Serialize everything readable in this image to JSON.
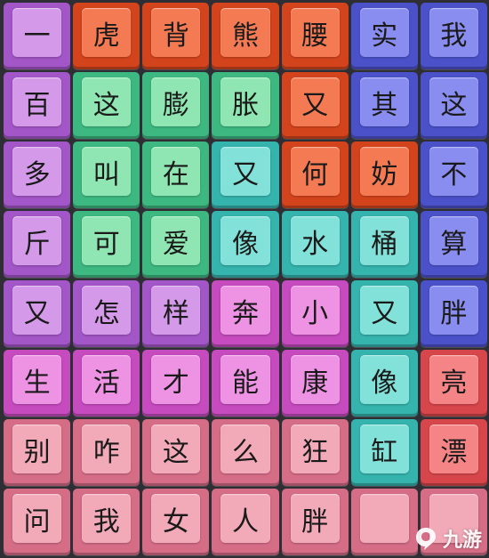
{
  "colors": {
    "purple": "#a356c7",
    "orange": "#d4441c",
    "blue": "#4b51c9",
    "green": "#3db880",
    "teal": "#35b3ad",
    "magenta": "#c64bbf",
    "pink": "#d66d87",
    "red": "#d6464a"
  },
  "board": {
    "rows": [
      [
        {
          "char": "一",
          "color": "purple"
        },
        {
          "char": "虎",
          "color": "orange"
        },
        {
          "char": "背",
          "color": "orange"
        },
        {
          "char": "熊",
          "color": "orange"
        },
        {
          "char": "腰",
          "color": "orange"
        },
        {
          "char": "实",
          "color": "blue"
        },
        {
          "char": "我",
          "color": "blue"
        }
      ],
      [
        {
          "char": "百",
          "color": "purple"
        },
        {
          "char": "这",
          "color": "green"
        },
        {
          "char": "膨",
          "color": "green"
        },
        {
          "char": "胀",
          "color": "green"
        },
        {
          "char": "又",
          "color": "orange"
        },
        {
          "char": "其",
          "color": "blue"
        },
        {
          "char": "这",
          "color": "blue"
        }
      ],
      [
        {
          "char": "多",
          "color": "purple"
        },
        {
          "char": "叫",
          "color": "green"
        },
        {
          "char": "在",
          "color": "green"
        },
        {
          "char": "又",
          "color": "teal"
        },
        {
          "char": "何",
          "color": "orange"
        },
        {
          "char": "妨",
          "color": "orange"
        },
        {
          "char": "不",
          "color": "blue"
        }
      ],
      [
        {
          "char": "斤",
          "color": "purple"
        },
        {
          "char": "可",
          "color": "green"
        },
        {
          "char": "爱",
          "color": "green"
        },
        {
          "char": "像",
          "color": "teal"
        },
        {
          "char": "水",
          "color": "teal"
        },
        {
          "char": "桶",
          "color": "teal"
        },
        {
          "char": "算",
          "color": "blue"
        }
      ],
      [
        {
          "char": "又",
          "color": "purple"
        },
        {
          "char": "怎",
          "color": "purple"
        },
        {
          "char": "样",
          "color": "purple"
        },
        {
          "char": "奔",
          "color": "magenta"
        },
        {
          "char": "小",
          "color": "magenta"
        },
        {
          "char": "又",
          "color": "teal"
        },
        {
          "char": "胖",
          "color": "blue"
        }
      ],
      [
        {
          "char": "生",
          "color": "magenta"
        },
        {
          "char": "活",
          "color": "magenta"
        },
        {
          "char": "才",
          "color": "magenta"
        },
        {
          "char": "能",
          "color": "magenta"
        },
        {
          "char": "康",
          "color": "magenta"
        },
        {
          "char": "像",
          "color": "teal"
        },
        {
          "char": "亮",
          "color": "red"
        }
      ],
      [
        {
          "char": "别",
          "color": "pink"
        },
        {
          "char": "咋",
          "color": "pink"
        },
        {
          "char": "这",
          "color": "pink"
        },
        {
          "char": "么",
          "color": "pink"
        },
        {
          "char": "狂",
          "color": "pink"
        },
        {
          "char": "缸",
          "color": "teal"
        },
        {
          "char": "漂",
          "color": "red"
        }
      ],
      [
        {
          "char": "问",
          "color": "pink"
        },
        {
          "char": "我",
          "color": "pink"
        },
        {
          "char": "女",
          "color": "pink"
        },
        {
          "char": "人",
          "color": "pink"
        },
        {
          "char": "胖",
          "color": "pink"
        },
        {
          "char": "",
          "color": "pink"
        },
        {
          "char": "",
          "color": "pink"
        }
      ]
    ]
  },
  "watermark": {
    "text": "九游",
    "icon": "9game-logo-icon"
  }
}
